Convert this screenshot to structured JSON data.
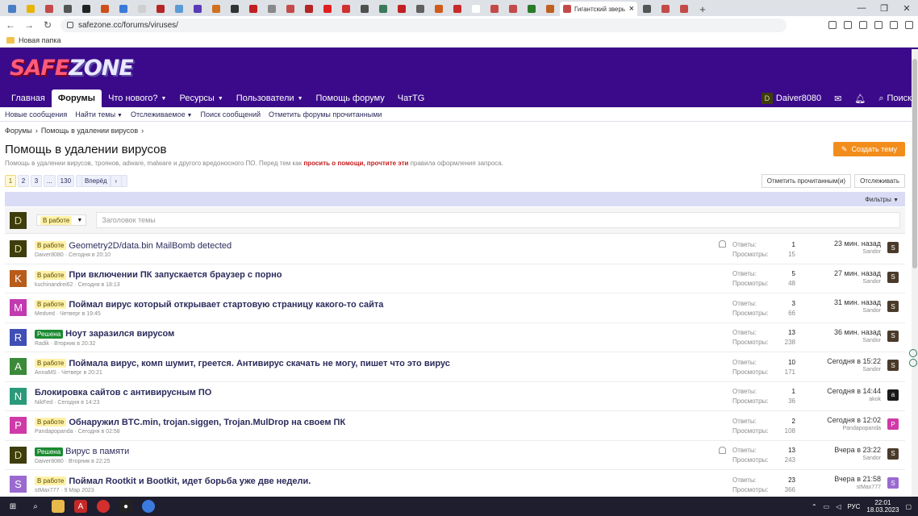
{
  "browser": {
    "tabs": [
      {
        "color": "#4a7ec4"
      },
      {
        "color": "#e8b400"
      },
      {
        "color": "#c44a4a"
      },
      {
        "color": "#555555"
      },
      {
        "color": "#222222"
      },
      {
        "color": "#d04e1b"
      },
      {
        "color": "#3a7ad8"
      },
      {
        "color": "#cfcfcf"
      },
      {
        "color": "#b52525"
      },
      {
        "color": "#5b9bd5"
      },
      {
        "color": "#5a3ab8"
      },
      {
        "color": "#d07020"
      },
      {
        "color": "#333333"
      },
      {
        "color": "#c02020"
      },
      {
        "color": "#888888"
      },
      {
        "color": "#c44a4a"
      },
      {
        "color": "#b52525"
      },
      {
        "color": "#e02020"
      },
      {
        "color": "#d03030"
      },
      {
        "color": "#505050"
      },
      {
        "color": "#3a7a5a"
      },
      {
        "color": "#c02020"
      },
      {
        "color": "#606060"
      },
      {
        "color": "#d05a1a"
      },
      {
        "color": "#c82a2a"
      },
      {
        "color": "#ffffff"
      },
      {
        "color": "#c44a4a"
      },
      {
        "color": "#c44a4a"
      },
      {
        "color": "#2a7a2a"
      },
      {
        "color": "#c06020"
      },
      {
        "color": "#555555"
      },
      {
        "color": "#c44a4a"
      },
      {
        "color": "#c44a4a"
      }
    ],
    "active_tab_title": "Гигантский зверь Арса...",
    "url": "safezone.cc/forums/viruses/",
    "bookmark_folder": "Новая папка"
  },
  "site": {
    "logo_main": "SAFE",
    "logo_accent": "ZONE",
    "nav": [
      {
        "label": "Главная",
        "caret": false,
        "active": false
      },
      {
        "label": "Форумы",
        "caret": false,
        "active": true
      },
      {
        "label": "Что нового?",
        "caret": true,
        "active": false
      },
      {
        "label": "Ресурсы",
        "caret": true,
        "active": false
      },
      {
        "label": "Пользователи",
        "caret": true,
        "active": false
      },
      {
        "label": "Помощь форуму",
        "caret": false,
        "active": false
      },
      {
        "label": "ЧатTG",
        "caret": false,
        "active": false
      }
    ],
    "user": {
      "initial": "D",
      "name": "Daiver8080"
    },
    "search_label": "Поиск",
    "subnav": [
      {
        "label": "Новые сообщения",
        "caret": false
      },
      {
        "label": "Найти темы",
        "caret": true
      },
      {
        "label": "Отслеживаемое",
        "caret": true
      },
      {
        "label": "Поиск сообщений",
        "caret": false
      },
      {
        "label": "Отметить форумы прочитанными",
        "caret": false
      }
    ],
    "breadcrumbs": [
      "Форумы",
      "Помощь в удалении вирусов"
    ]
  },
  "page": {
    "title": "Помощь в удалении вирусов",
    "desc_start": "Помощь в удалении вирусов, троянов, adware, malware и другого вредоносного ПО. Перед тем как ",
    "desc_link": "просить о помощи, прочтите эти",
    "desc_end": " правила оформления запроса.",
    "create_label": "Создать тему",
    "pages": [
      "1",
      "2",
      "3",
      "...",
      "130"
    ],
    "next_label": "Вперёд",
    "mark_read_label": "Отметить прочитанным(и)",
    "watch_label": "Отслеживать",
    "filters_label": "Фильтры",
    "quick_prefix": "В работе",
    "quick_placeholder": "Заголовок темы",
    "quick_avatar": "D",
    "replies_label": "Ответы:",
    "views_label": "Просмотры:"
  },
  "threads": [
    {
      "av": "D",
      "avc": "#3d3d0d",
      "prefix": "В работе",
      "green": false,
      "title": "Geometry2D/data.bin MailBomb detected",
      "bold": false,
      "author": "Daiver8080",
      "date": "Сегодня в 20:10",
      "replies": "1",
      "views": "15",
      "last_time": "23 мин. назад",
      "last_user": "Sandor",
      "lav": "S",
      "lavc": "#4a3a2a",
      "bell": true
    },
    {
      "av": "K",
      "avc": "#b85c1a",
      "prefix": "В работе",
      "green": false,
      "title": "При включении ПК запускается браузер с порно",
      "bold": true,
      "author": "kuchinandrei62",
      "date": "Сегодня в 18:13",
      "replies": "5",
      "views": "48",
      "last_time": "27 мин. назад",
      "last_user": "Sandor",
      "lav": "S",
      "lavc": "#4a3a2a",
      "bell": false
    },
    {
      "av": "M",
      "avc": "#c23ab0",
      "prefix": "В работе",
      "green": false,
      "title": "Поймал вирус который открывает стартовую страницу какого-то сайта",
      "bold": true,
      "author": "Medved",
      "date": "Четверг в 19:45",
      "replies": "3",
      "views": "66",
      "last_time": "31 мин. назад",
      "last_user": "Sandor",
      "lav": "S",
      "lavc": "#4a3a2a",
      "bell": false
    },
    {
      "av": "R",
      "avc": "#3f4fb5",
      "prefix": "Решена",
      "green": true,
      "title": "Ноут заразился вирусом",
      "bold": true,
      "author": "Radik",
      "date": "Вторник в 20:32",
      "replies": "13",
      "views": "238",
      "last_time": "36 мин. назад",
      "last_user": "Sandor",
      "lav": "S",
      "lavc": "#4a3a2a",
      "bell": false
    },
    {
      "av": "A",
      "avc": "#3a8a3a",
      "prefix": "В работе",
      "green": false,
      "title": "Поймала вирус, комп шумит, греется. Антивирус скачать не могу, пишет что это вирус",
      "bold": true,
      "author": "AnnaMS",
      "date": "Четверг в 20:21",
      "replies": "10",
      "views": "171",
      "last_time": "Сегодня в 15:22",
      "last_user": "Sandor",
      "lav": "S",
      "lavc": "#4a3a2a",
      "bell": false
    },
    {
      "av": "N",
      "avc": "#2a9a7a",
      "prefix": "",
      "green": false,
      "title": "Блокировка сайтов с антивирусным ПО",
      "bold": true,
      "author": "NikFed",
      "date": "Сегодня в 14:23",
      "replies": "1",
      "views": "36",
      "last_time": "Сегодня в 14:44",
      "last_user": "akok",
      "lav": "a",
      "lavc": "#1a1a1a",
      "bell": false
    },
    {
      "av": "P",
      "avc": "#d03aa8",
      "prefix": "В работе",
      "green": false,
      "title": "Обнаружил BTC.min, trojan.siggen, Trojan.MulDrop на своем ПК",
      "bold": true,
      "author": "Pandapopanda",
      "date": "Сегодня в 02:58",
      "replies": "2",
      "views": "108",
      "last_time": "Сегодня в 12:02",
      "last_user": "Pandapopanda",
      "lav": "P",
      "lavc": "#d03aa8",
      "bell": false
    },
    {
      "av": "D",
      "avc": "#3d3d0d",
      "prefix": "Решена",
      "green": true,
      "title": "Вирус в памяти",
      "bold": false,
      "author": "Daiver8080",
      "date": "Вторник в 22:25",
      "replies": "13",
      "views": "243",
      "last_time": "Вчера в 23:22",
      "last_user": "Sandor",
      "lav": "S",
      "lavc": "#4a3a2a",
      "bell": true
    },
    {
      "av": "S",
      "avc": "#9a6ad0",
      "prefix": "В работе",
      "green": false,
      "title": "Поймал Rootkit и Bootkit, идет борьба уже две недели.",
      "bold": true,
      "author": "stMax777",
      "date": "9 Мар 2023",
      "replies": "23",
      "views": "366",
      "last_time": "Вчера в 21:58",
      "last_user": "stMax777",
      "lav": "S",
      "lavc": "#9a6ad0",
      "bell": false
    }
  ],
  "taskbar": {
    "lang": "РУС",
    "time": "22:01",
    "date": "18.03.2023"
  }
}
